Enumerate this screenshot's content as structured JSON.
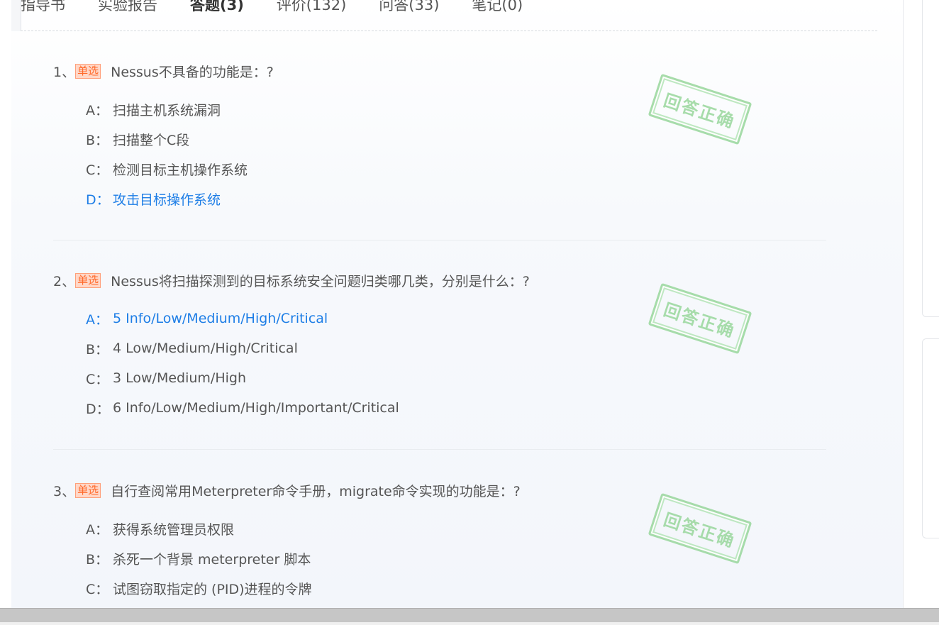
{
  "tabs": [
    {
      "label": "指导书",
      "active": false
    },
    {
      "label": "实验报告",
      "active": false
    },
    {
      "label": "答题(3)",
      "active": true
    },
    {
      "label": "评价(132)",
      "active": false
    },
    {
      "label": "问答(33)",
      "active": false
    },
    {
      "label": "笔记(0)",
      "active": false
    }
  ],
  "questions": [
    {
      "number": "1、",
      "type": "单选",
      "text": "Nessus不具备的功能是：?",
      "stamp": "回答正确",
      "options": [
        {
          "key": "A：",
          "text": "扫描主机系统漏洞",
          "correct": false
        },
        {
          "key": "B：",
          "text": "扫描整个C段",
          "correct": false
        },
        {
          "key": "C：",
          "text": "检测目标主机操作系统",
          "correct": false
        },
        {
          "key": "D：",
          "text": "攻击目标操作系统",
          "correct": true
        }
      ]
    },
    {
      "number": "2、",
      "type": "单选",
      "text": "Nessus将扫描探测到的目标系统安全问题归类哪几类，分别是什么：?",
      "stamp": "回答正确",
      "options": [
        {
          "key": "A：",
          "text": "5 Info/Low/Medium/High/Critical",
          "correct": true
        },
        {
          "key": "B：",
          "text": "4 Low/Medium/High/Critical",
          "correct": false
        },
        {
          "key": "C：",
          "text": "3 Low/Medium/High",
          "correct": false
        },
        {
          "key": "D：",
          "text": "6 Info/Low/Medium/High/Important/Critical",
          "correct": false
        }
      ]
    },
    {
      "number": "3、",
      "type": "单选",
      "text": "自行查阅常用Meterpreter命令手册，migrate命令实现的功能是：?",
      "stamp": "回答正确",
      "options": [
        {
          "key": "A：",
          "text": "获得系统管理员权限",
          "correct": false
        },
        {
          "key": "B：",
          "text": "杀死一个背景 meterpreter 脚本",
          "correct": false
        },
        {
          "key": "C：",
          "text": "试图窃取指定的 (PID)进程的令牌",
          "correct": false
        }
      ]
    }
  ],
  "colors": {
    "correct_option": "#1e7ee6",
    "badge_text": "#ff6a2a",
    "badge_bg": "#ffd7c7",
    "stamp": "#9ed9a2",
    "text": "#555555"
  }
}
